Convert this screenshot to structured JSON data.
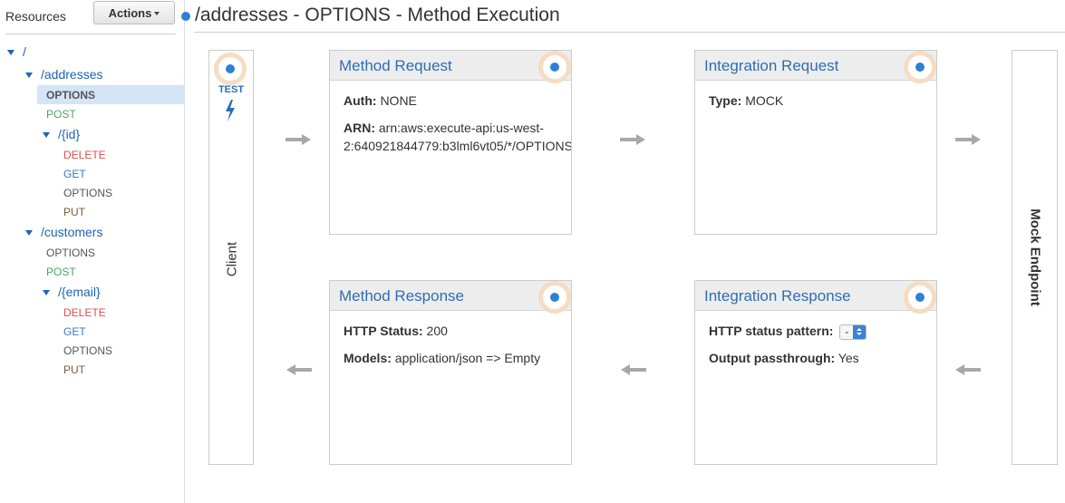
{
  "sidebar": {
    "title": "Resources",
    "actions_label": "Actions",
    "tree": {
      "root": "/",
      "addresses": "/addresses",
      "addresses_methods": [
        "OPTIONS",
        "POST"
      ],
      "addresses_id": "/{id}",
      "addresses_id_methods": [
        "DELETE",
        "GET",
        "OPTIONS",
        "PUT"
      ],
      "customers": "/customers",
      "customers_methods": [
        "OPTIONS",
        "POST"
      ],
      "customers_email": "/{email}",
      "customers_email_methods": [
        "DELETE",
        "GET",
        "OPTIONS",
        "PUT"
      ]
    },
    "selected": "OPTIONS"
  },
  "header": {
    "title": "/addresses - OPTIONS - Method Execution"
  },
  "client": {
    "test_label": "TEST",
    "label": "Client"
  },
  "mock": {
    "label": "Mock Endpoint"
  },
  "method_request": {
    "title": "Method Request",
    "auth_key": "Auth:",
    "auth_val": "NONE",
    "arn_key": "ARN:",
    "arn_line1": "arn:aws:execute-api:us-west-",
    "arn_line2": "2:640921844779:b3lml6vt05/*/OPTIONS"
  },
  "integration_request": {
    "title": "Integration Request",
    "type_key": "Type:",
    "type_val": "MOCK"
  },
  "method_response": {
    "title": "Method Response",
    "status_key": "HTTP Status:",
    "status_val": "200",
    "models_key": "Models:",
    "models_val": "application/json => Empty"
  },
  "integration_response": {
    "title": "Integration Response",
    "pattern_key": "HTTP status pattern:",
    "pattern_val": "-",
    "passthrough_key": "Output passthrough:",
    "passthrough_val": "Yes"
  },
  "colors": {
    "accent": "#2d80d2",
    "link": "#2f6eb4",
    "ring": "#f5dcc2",
    "selected_bg": "#d3e5f7"
  }
}
